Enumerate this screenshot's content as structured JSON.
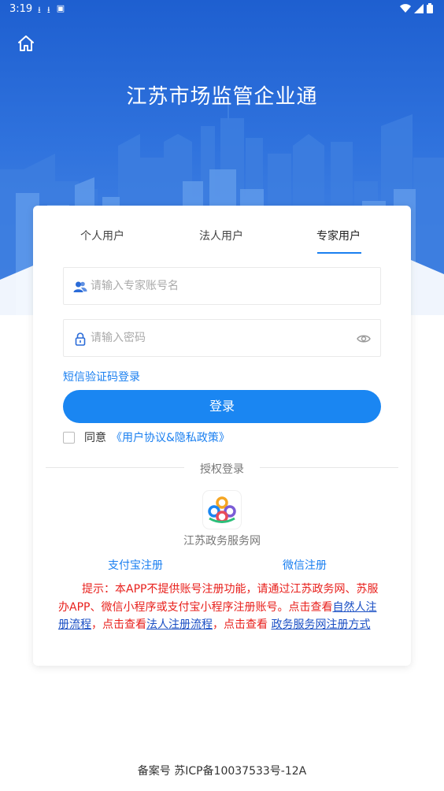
{
  "status_bar": {
    "time": "3:19",
    "left_icons": [
      "download-icon",
      "download-icon",
      "app-icon"
    ],
    "right_icons": [
      "wifi-icon",
      "signal-icon",
      "battery-icon"
    ]
  },
  "header": {
    "title": "江苏市场监管企业通",
    "home_icon": "home-icon",
    "bg_color": "#2a6bd8"
  },
  "tabs": [
    {
      "label": "个人用户",
      "active": false
    },
    {
      "label": "法人用户",
      "active": false
    },
    {
      "label": "专家用户",
      "active": true
    }
  ],
  "form": {
    "account_placeholder": "请输入专家账号名",
    "account_value": "",
    "password_placeholder": "请输入密码",
    "password_value": "",
    "sms_login_link": "短信验证码登录",
    "login_button": "登录",
    "agree_checked": false,
    "agree_text": "同意",
    "agree_link": "《用户协议&隐私政策》"
  },
  "auth": {
    "label": "授权登录",
    "gov_service_label": "江苏政务服务网",
    "alipay_register": "支付宝注册",
    "wechat_register": "微信注册"
  },
  "notice": {
    "text1": "提示：本APP不提供账号注册功能，请通过江苏政务网、苏服办APP、微信小程序或支付宝小程序注册账号。点击查看",
    "link1": "自然人注册流程",
    "text2": "，点击查看",
    "link2": "法人注册流程",
    "text3": "，点击查看 ",
    "link3": "政务服务网注册方式"
  },
  "footer": {
    "text": "备案号 苏ICP备10037533号-12A"
  },
  "colors": {
    "accent": "#1a86f2",
    "link": "#1a7ff0",
    "notice": "#e8201c"
  }
}
